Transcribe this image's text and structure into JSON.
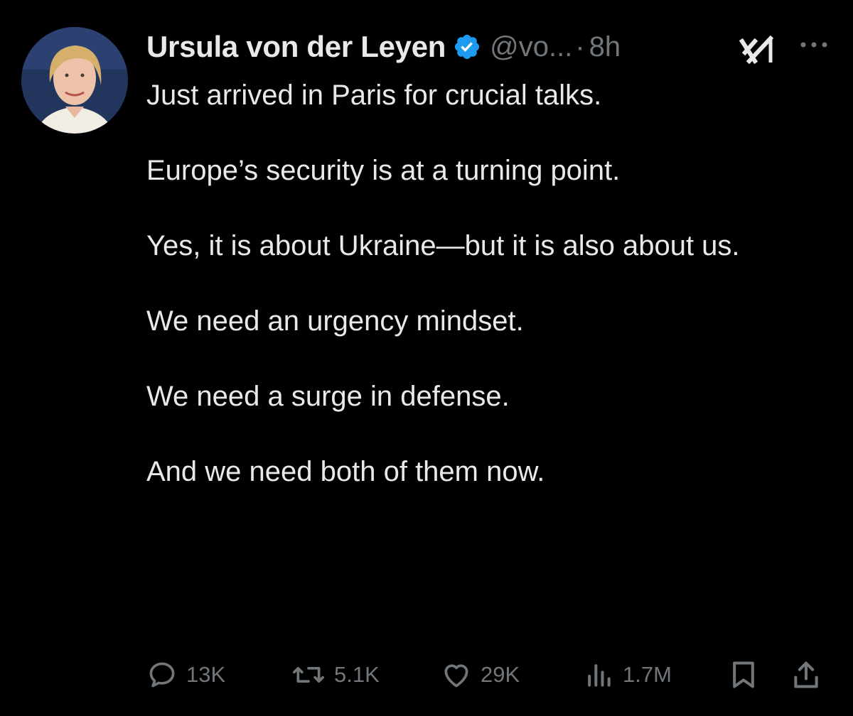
{
  "tweet": {
    "author": {
      "name": "Ursula von der Leyen",
      "handle": "@vo...",
      "verified": true
    },
    "separator": "·",
    "time": "8h",
    "paragraphs": [
      "Just arrived in Paris for crucial talks.",
      "Europe’s security is at a turning point.",
      "Yes, it is about Ukraine—but it is also about us.",
      "We need an urgency mindset.",
      "We need a surge in defense.",
      "And we need both of them now."
    ],
    "metrics": {
      "replies": "13K",
      "reposts": "5.1K",
      "likes": "29K",
      "views": "1.7M"
    }
  },
  "icons": {
    "verified": "verified-badge-icon",
    "grok": "grok-icon",
    "more": "more-options-icon",
    "reply": "reply-icon",
    "repost": "repost-icon",
    "like": "like-icon",
    "views": "views-icon",
    "bookmark": "bookmark-icon",
    "share": "share-icon"
  },
  "colors": {
    "background": "#000000",
    "text_primary": "#e7e9ea",
    "text_secondary": "#71767b",
    "verified_badge": "#1d9bf0"
  }
}
